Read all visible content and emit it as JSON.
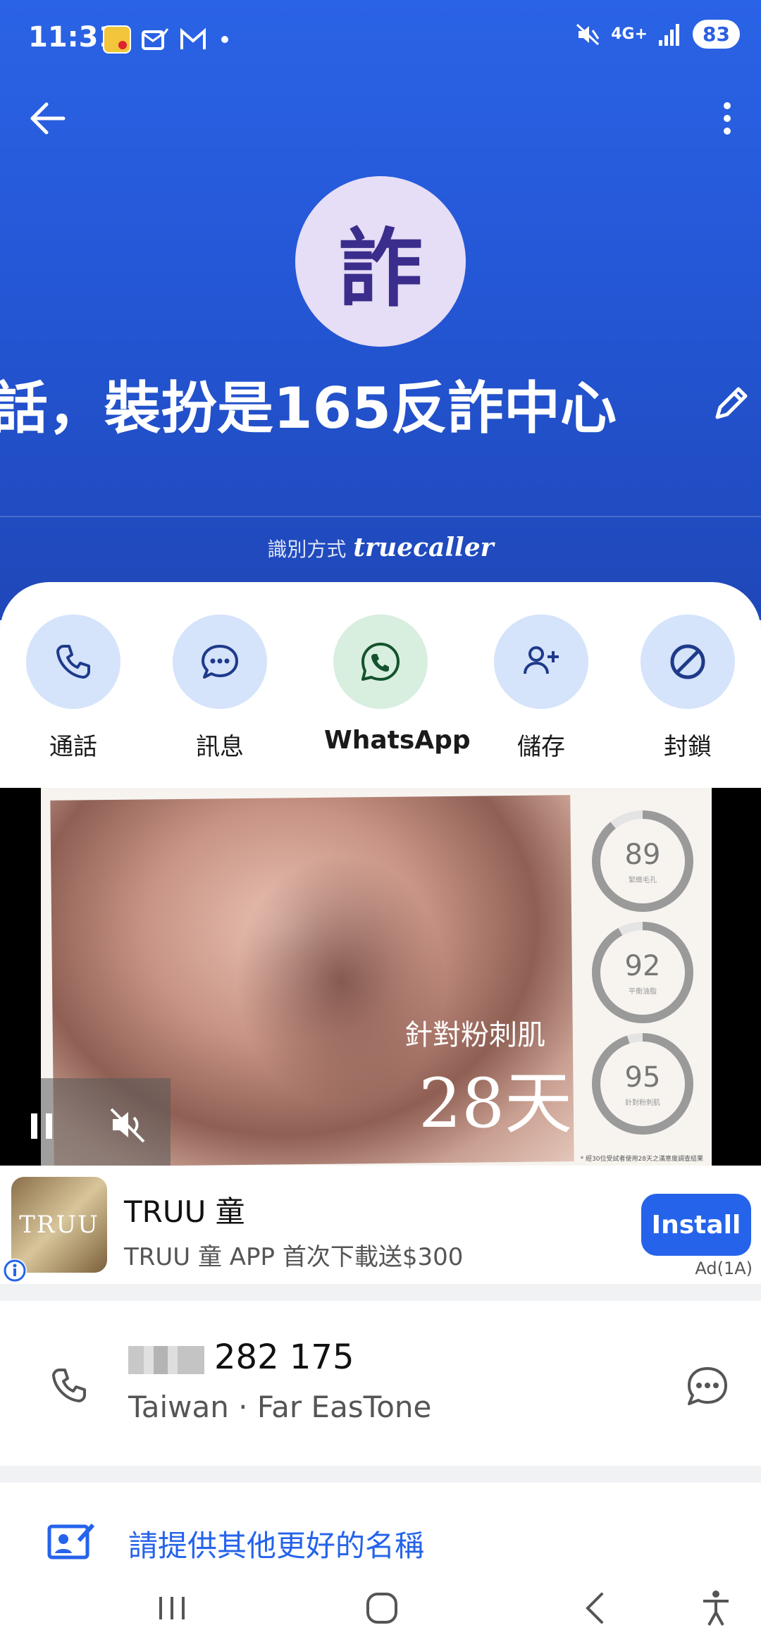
{
  "status": {
    "time": "11:31",
    "network": "4G+",
    "battery": "83"
  },
  "contact": {
    "avatar_char": "詐",
    "name": "話，裝扮是165反詐中心",
    "identified_by": "識別方式",
    "brand": "truecaller"
  },
  "actions": [
    {
      "label": "通話",
      "icon": "phone-icon"
    },
    {
      "label": "訊息",
      "icon": "message-icon"
    },
    {
      "label": "WhatsApp",
      "icon": "whatsapp-icon"
    },
    {
      "label": "儲存",
      "icon": "add-person-icon"
    },
    {
      "label": "封鎖",
      "icon": "block-icon"
    }
  ],
  "ad": {
    "overlay_line1": "針對粉刺肌",
    "overlay_line2": "28天",
    "gauges": [
      {
        "value": "89",
        "sub": "緊緻毛孔",
        "fraction": 0.89
      },
      {
        "value": "92",
        "sub": "平衡油脂",
        "fraction": 0.92
      },
      {
        "value": "95",
        "sub": "針對粉刺肌",
        "fraction": 0.95
      }
    ],
    "footnote": "* 經30位受試者使用28天之滿意度調查結果",
    "logo_text": "TRUU",
    "title": "TRUU 童",
    "description": "TRUU 童 APP 首次下載送$300",
    "install_label": "Install",
    "ad_label": "Ad(1A)"
  },
  "number": {
    "digits": "282 175",
    "carrier": "Taiwan · Far EasTone"
  },
  "suggest": {
    "text": "請提供其他更好的名稱"
  },
  "colors": {
    "header": "#2b63e6",
    "accent": "#2563eb",
    "avatar_bg": "#e6ddf6"
  }
}
